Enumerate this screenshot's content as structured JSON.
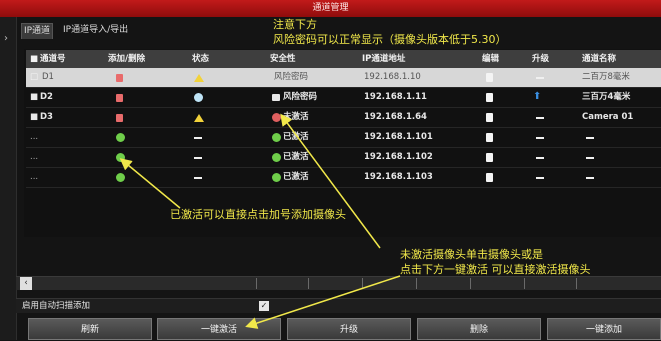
{
  "window": {
    "title": "通道管理"
  },
  "tabs": [
    {
      "label": "IP通道"
    },
    {
      "label": "IP通道导入/导出"
    }
  ],
  "table": {
    "columns": [
      "通道号",
      "添加/删除",
      "状态",
      "安全性",
      "IP通道地址",
      "编辑",
      "升级",
      "通道名称"
    ],
    "rows": [
      {
        "channel": "D1",
        "security": "风险密码",
        "ip": "192.168.1.10",
        "name": "二百万8毫米",
        "status_icon": "warning-icon",
        "selected": true
      },
      {
        "channel": "D2",
        "security": "风险密码",
        "ip": "192.168.1.11",
        "name": "三百万4毫米",
        "status_icon": "online-icon",
        "selected": false
      },
      {
        "channel": "D3",
        "security": "未激活",
        "ip": "192.168.1.64",
        "name": "Camera 01",
        "status_icon": "warning-icon",
        "selected": false
      },
      {
        "channel": "...",
        "security": "已激活",
        "ip": "192.168.1.101",
        "name": "",
        "status_icon": "dash-icon",
        "selected": false
      },
      {
        "channel": "...",
        "security": "已激活",
        "ip": "192.168.1.102",
        "name": "",
        "status_icon": "dash-icon",
        "selected": false
      },
      {
        "channel": "...",
        "security": "已激活",
        "ip": "192.168.1.103",
        "name": "",
        "status_icon": "dash-icon",
        "selected": false
      }
    ]
  },
  "auto_scan": {
    "label": "启用自动扫描添加",
    "checked": true
  },
  "buttons": {
    "refresh": "刷新",
    "one_click_activate": "一键激活",
    "upgrade": "升级",
    "delete": "删除",
    "one_click_add": "一键添加"
  },
  "annotations": {
    "note_line1": "注意下方",
    "note_line2": "风险密码可以正常显示（摄像头版本低于5.30）",
    "activated_note": "已激活可以直接点击加号添加摄像头",
    "inactive_line1": "未激活摄像头单击摄像头或是",
    "inactive_line2": "点击下方一键激活 可以直接激活摄像头"
  },
  "colors": {
    "annotation": "#f1e84a",
    "titlebar": "#b01515",
    "selected_row": "#d7d7d7",
    "ok_green": "#6fce4a"
  }
}
